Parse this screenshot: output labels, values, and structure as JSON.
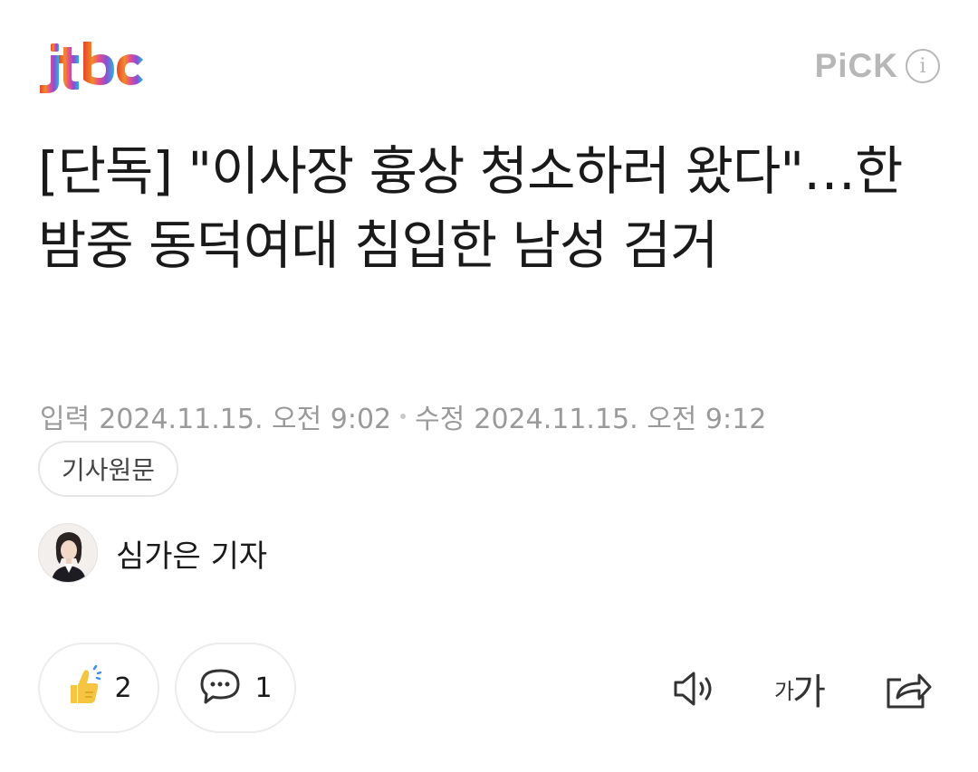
{
  "header": {
    "logo_text": "jtbc",
    "pick_label": "PiCK",
    "info_glyph": "i"
  },
  "article": {
    "title": "[단독] \"이사장 흉상 청소하러 왔다\"…한밤중 동덕여대 침입한 남성 검거",
    "published_label": "입력",
    "published_time": "2024.11.15. 오전 9:02",
    "modified_label": "수정",
    "modified_time": "2024.11.15. 오전 9:12",
    "original_button": "기사원문"
  },
  "reporter": {
    "name": "심가은 기자"
  },
  "actions": {
    "like_count": "2",
    "comment_count": "1",
    "font_small": "가",
    "font_large": "가"
  },
  "icons": {
    "like": "thumbs-up-icon",
    "comment": "speech-bubble-icon",
    "tts": "speaker-icon",
    "font_size": "font-size-icon",
    "share": "share-icon",
    "info": "info-icon"
  },
  "colors": {
    "pick": "#b7b7b7",
    "meta_text": "#9a9a9a",
    "like_yellow": "#f5c542",
    "like_blue": "#3d8ef0"
  }
}
